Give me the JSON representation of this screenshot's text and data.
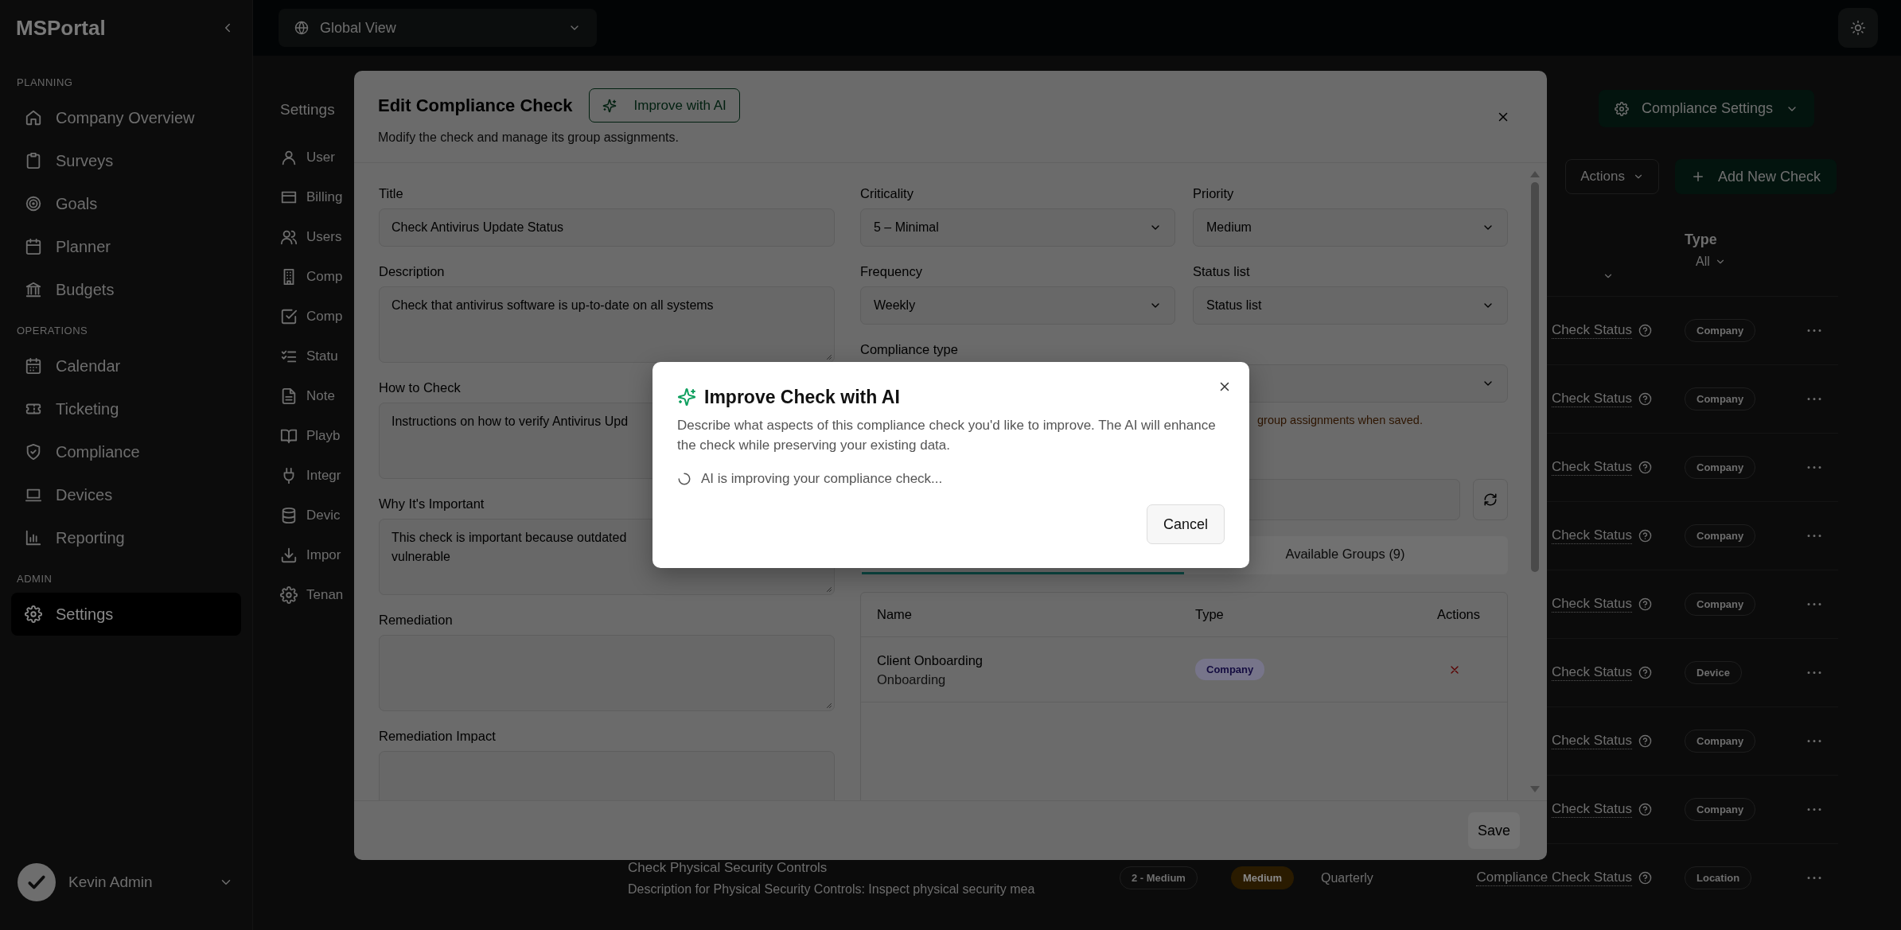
{
  "sidebar": {
    "title": "MSPortal",
    "sections": [
      {
        "heading": "PLANNING",
        "items": [
          {
            "label": "Company Overview",
            "selected": false
          },
          {
            "label": "Surveys",
            "selected": false
          },
          {
            "label": "Goals",
            "selected": false
          },
          {
            "label": "Planner",
            "selected": false
          },
          {
            "label": "Budgets",
            "selected": false
          }
        ]
      },
      {
        "heading": "OPERATIONS",
        "items": [
          {
            "label": "Calendar",
            "selected": false
          },
          {
            "label": "Ticketing",
            "selected": false
          },
          {
            "label": "Compliance",
            "selected": false
          },
          {
            "label": "Devices",
            "selected": false
          },
          {
            "label": "Reporting",
            "selected": false
          }
        ]
      },
      {
        "heading": "ADMIN",
        "items": [
          {
            "label": "Settings",
            "selected": true
          }
        ]
      }
    ],
    "user": {
      "name": "Kevin Admin"
    }
  },
  "topbar": {
    "scope": "Global View"
  },
  "settings_nav": {
    "title": "Settings",
    "items": [
      "User",
      "Billing",
      "Users",
      "Comp",
      "Comp",
      "Statu",
      "Note",
      "Playb",
      "Integr",
      "Devic",
      "Impor",
      "Tenan"
    ]
  },
  "page_actions": {
    "settings_button": "Compliance Settings",
    "actions_button": "Actions",
    "add_button": "Add New Check"
  },
  "checks_table": {
    "type_column": "Type",
    "type_filter": "All",
    "rows": [
      {
        "status": "Check Status",
        "type": "Company"
      },
      {
        "status": "Check Status",
        "type": "Company"
      },
      {
        "status": "Check Status",
        "type": "Company"
      },
      {
        "status": "Check Status",
        "type": "Company"
      },
      {
        "status": "Check Status",
        "type": "Company"
      },
      {
        "status": "Check Status",
        "type": "Device"
      },
      {
        "status": "Check Status",
        "type": "Company"
      },
      {
        "status": "Check Status",
        "type": "Company"
      },
      {
        "name": "Check Physical Security Controls",
        "description": "Description for Physical Security Controls: Inspect physical security mea",
        "criticality": "2 - Medium",
        "priority": "Medium",
        "frequency": "Quarterly",
        "status": "Compliance Check Status",
        "type": "Location"
      }
    ]
  },
  "edit_dialog": {
    "title": "Edit Compliance Check",
    "ai_button": "Improve with AI",
    "subtitle": "Modify the check and manage its group assignments.",
    "left_fields": [
      {
        "label": "Title",
        "kind": "input",
        "value": "Check Antivirus Update Status"
      },
      {
        "label": "Description",
        "kind": "textarea",
        "value": "Check that antivirus software is up-to-date on all systems"
      },
      {
        "label": "How to Check",
        "kind": "textarea",
        "value": "Instructions on how to verify Antivirus Upd"
      },
      {
        "label": "Why It's Important",
        "kind": "textarea",
        "value": "This check is important because outdated\nvulnerable"
      },
      {
        "label": "Remediation",
        "kind": "textarea"
      },
      {
        "label": "Remediation Impact",
        "kind": "textarea"
      }
    ],
    "right_fields": [
      {
        "label": "Criticality",
        "value": "5 – Minimal"
      },
      {
        "label": "Priority",
        "value": "Medium"
      },
      {
        "label": "Frequency",
        "value": "Weekly"
      },
      {
        "label": "Status list",
        "value": "Status list"
      },
      {
        "label": "Compliance type"
      }
    ],
    "warning": "group assignments when saved.",
    "group_tabs": [
      {
        "selected": true
      },
      {
        "label": "Available Groups (9)",
        "selected": false
      }
    ],
    "groups_table": {
      "columns": [
        "Name",
        "Type",
        "Actions"
      ],
      "rows": [
        {
          "name": "Client Onboarding",
          "category": "Onboarding",
          "type": "Company"
        }
      ]
    },
    "save_button": "Save"
  },
  "ai_dialog": {
    "title": "Improve Check with AI",
    "description": "Describe what aspects of this compliance check you'd like to improve. The AI will enhance the check while preserving your existing data.",
    "status": "AI is improving your compliance check...",
    "cancel_button": "Cancel"
  }
}
